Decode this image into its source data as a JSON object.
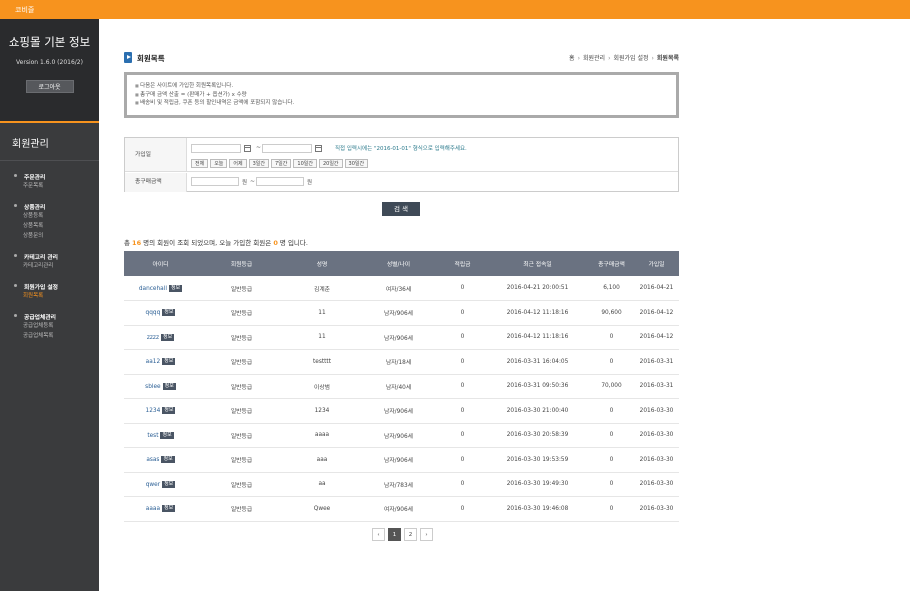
{
  "topbar": {
    "brand": "코비즐"
  },
  "sidebar": {
    "title": "쇼핑몰 기본 정보",
    "version": "Version 1.6.0 (2016/2)",
    "logout": "로그아웃",
    "section": "회원관리",
    "groups": [
      {
        "title": "주문관리",
        "items": [
          "주문목록"
        ]
      },
      {
        "title": "상품관리",
        "items": [
          "상품등록",
          "상품목록",
          "상품문의"
        ]
      },
      {
        "title": "카테고리 관리",
        "items": [
          "카테고리관리"
        ]
      },
      {
        "title": "회원가입 설정",
        "items": [
          "회원목록"
        ]
      },
      {
        "title": "공급업체관리",
        "items": [
          "공급업체등록",
          "공급업체목록"
        ]
      }
    ],
    "active_item": "회원목록"
  },
  "page": {
    "title": "회원목록",
    "breadcrumb": [
      "홈",
      "회원관리",
      "회원가입 설정",
      "회원목록"
    ]
  },
  "notice": [
    "다음은 사이트에 가입한 회원목록입니다.",
    "총구매 금액 산출 = (판매가 + 옵션가) x 수량",
    "배송비 및 적립금, 쿠폰 등의 할인내역은 금액에 포함되지 않습니다."
  ],
  "search": {
    "join_label": "가입일",
    "join_hint": "직접 입력시에는 \"2016-01-01\" 형식으로 입력해주세요.",
    "quick": [
      "전체",
      "오늘",
      "어제",
      "3일간",
      "7일간",
      "10일간",
      "20일간",
      "30일간"
    ],
    "amount_label": "총구매금액",
    "won": "원",
    "tilde": "~",
    "button": "검 색"
  },
  "summary": {
    "p1": "총 ",
    "total": "16",
    "p2": " 명의 회원이 조회 되었으며, 오늘 가입한 회원은 ",
    "today": "0",
    "p3": " 명 입니다."
  },
  "table": {
    "headers": [
      "아이디",
      "회원등급",
      "성명",
      "성별/나이",
      "적립금",
      "최근 접속일",
      "총구매금액",
      "가입일"
    ],
    "badge": "정보",
    "rows": [
      [
        "dancehall",
        "일반등급",
        "김계춘",
        "여자/36세",
        "0",
        "2016-04-21 20:00:51",
        "6,100",
        "2016-04-21"
      ],
      [
        "qqqq",
        "일반등급",
        "11",
        "남자/906세",
        "0",
        "2016-04-12 11:18:16",
        "90,600",
        "2016-04-12"
      ],
      [
        "zzzz",
        "일반등급",
        "11",
        "남자/906세",
        "0",
        "2016-04-12 11:18:16",
        "0",
        "2016-04-12"
      ],
      [
        "aa12",
        "일반등급",
        "testttt",
        "남자/18세",
        "0",
        "2016-03-31 16:04:05",
        "0",
        "2016-03-31"
      ],
      [
        "sblee",
        "일반등급",
        "이상범",
        "남자/40세",
        "0",
        "2016-03-31 09:50:36",
        "70,000",
        "2016-03-31"
      ],
      [
        "1234",
        "일반등급",
        "1234",
        "남자/906세",
        "0",
        "2016-03-30 21:00:40",
        "0",
        "2016-03-30"
      ],
      [
        "test",
        "일반등급",
        "aaaa",
        "남자/906세",
        "0",
        "2016-03-30 20:58:39",
        "0",
        "2016-03-30"
      ],
      [
        "asas",
        "일반등급",
        "aaa",
        "남자/906세",
        "0",
        "2016-03-30 19:53:59",
        "0",
        "2016-03-30"
      ],
      [
        "qwer",
        "일반등급",
        "aa",
        "남자/783세",
        "0",
        "2016-03-30 19:49:30",
        "0",
        "2016-03-30"
      ],
      [
        "aaaa",
        "일반등급",
        "Qwee",
        "여자/906세",
        "0",
        "2016-03-30 19:46:08",
        "0",
        "2016-03-30"
      ]
    ]
  },
  "pager": {
    "prev": "‹",
    "pages": [
      "1",
      "2"
    ],
    "current": "1",
    "next": "›"
  }
}
